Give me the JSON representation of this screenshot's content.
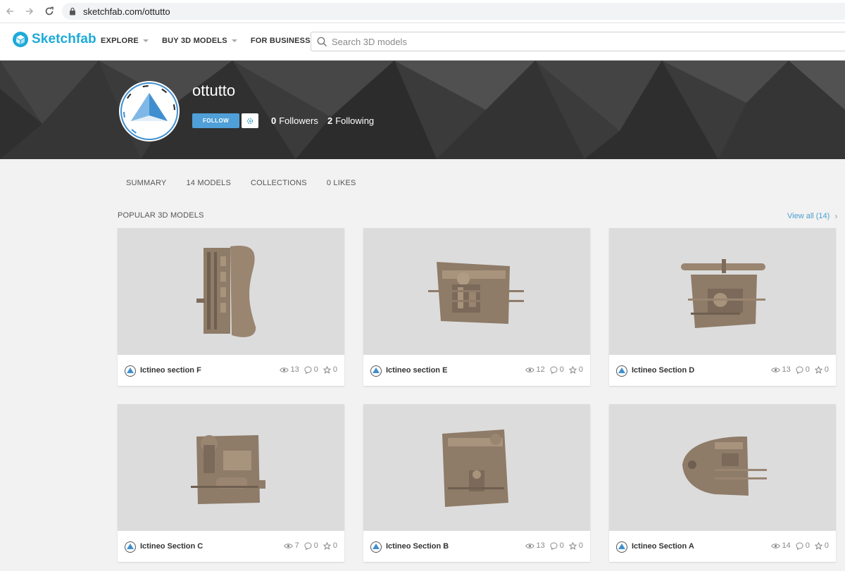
{
  "browser": {
    "url": "sketchfab.com/ottutto"
  },
  "header": {
    "logo_text": "Sketchfab",
    "nav": [
      {
        "label": "EXPLORE"
      },
      {
        "label": "BUY 3D MODELS"
      },
      {
        "label": "FOR BUSINESS"
      }
    ],
    "search_placeholder": "Search 3D models"
  },
  "profile": {
    "username": "ottutto",
    "follow_label": "FOLLOW",
    "followers_count": "0",
    "followers_label": "Followers",
    "following_count": "2",
    "following_label": "Following"
  },
  "tabs": [
    {
      "label": "SUMMARY"
    },
    {
      "label": "14 MODELS"
    },
    {
      "label": "COLLECTIONS"
    },
    {
      "label": "0 LIKES"
    }
  ],
  "popular": {
    "title": "POPULAR 3D MODELS",
    "view_all": "View all (14)",
    "models": [
      {
        "title": "Ictineo section F",
        "views": "13",
        "comments": "0",
        "likes": "0"
      },
      {
        "title": "Ictineo section E",
        "views": "12",
        "comments": "0",
        "likes": "0"
      },
      {
        "title": "Ictineo Section D",
        "views": "13",
        "comments": "0",
        "likes": "0"
      },
      {
        "title": "Ictineo Section C",
        "views": "7",
        "comments": "0",
        "likes": "0"
      },
      {
        "title": "Ictineo Section B",
        "views": "13",
        "comments": "0",
        "likes": "0"
      },
      {
        "title": "Ictineo Section A",
        "views": "14",
        "comments": "0",
        "likes": "0"
      }
    ]
  },
  "colors": {
    "accent": "#1caad9",
    "follow": "#4f9fd8",
    "model": "#8f7c69"
  }
}
